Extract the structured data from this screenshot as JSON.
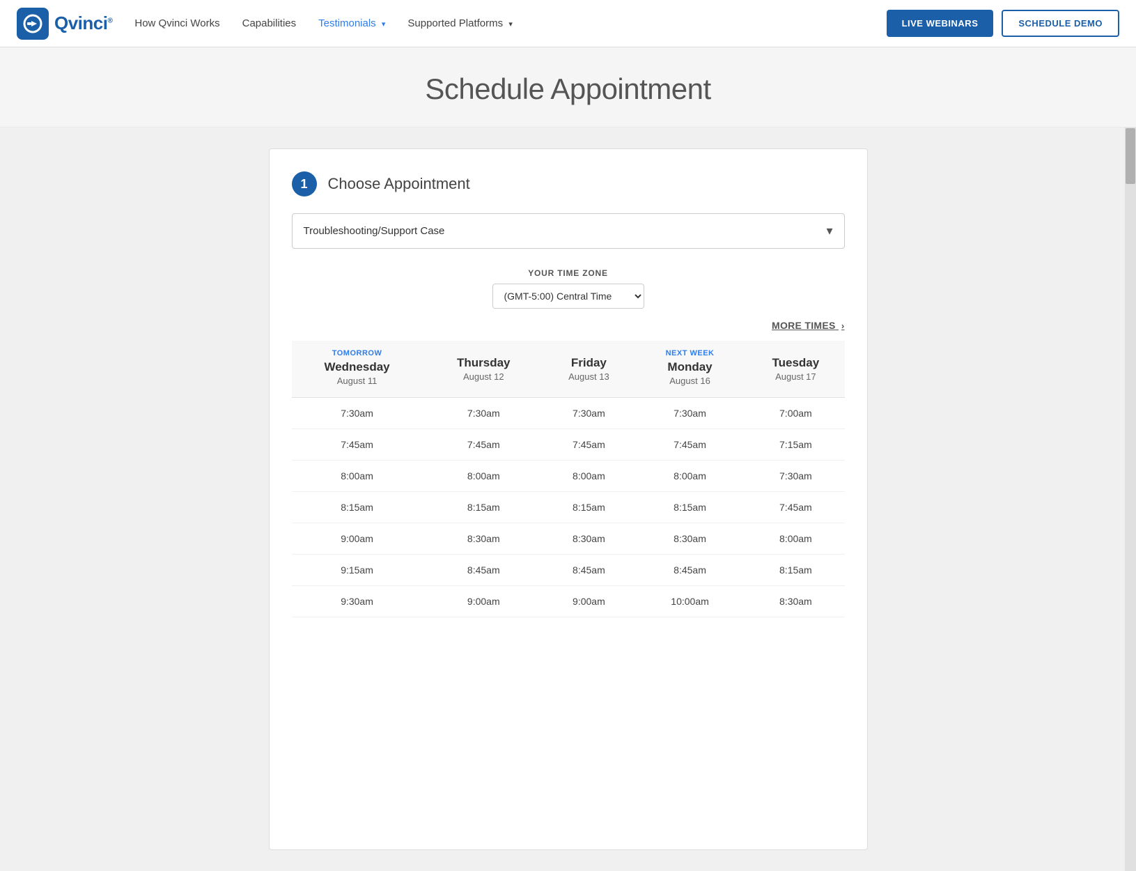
{
  "nav": {
    "logo_text": "Qvinci",
    "logo_sup": "®",
    "links": [
      {
        "label": "How Qvinci Works",
        "has_dropdown": false
      },
      {
        "label": "Capabilities",
        "has_dropdown": false
      },
      {
        "label": "Testimonials",
        "has_dropdown": true
      },
      {
        "label": "Supported Platforms",
        "has_dropdown": true
      }
    ],
    "btn_live": "LIVE WEBINARS",
    "btn_demo": "SCHEDULE DEMO"
  },
  "page": {
    "title": "Schedule Appointment"
  },
  "card": {
    "step_number": "1",
    "step_title": "Choose Appointment",
    "dropdown_label": "Troubleshooting/Support Case",
    "timezone_label": "YOUR TIME ZONE",
    "timezone_value": "(GMT-5:00) Central Time",
    "more_times": "MORE TIMES"
  },
  "calendar": {
    "columns": [
      {
        "tag": "TOMORROW",
        "day": "Wednesday",
        "date": "August 11",
        "times": [
          "7:30am",
          "7:45am",
          "8:00am",
          "8:15am",
          "9:00am",
          "9:15am",
          "9:30am"
        ]
      },
      {
        "tag": "",
        "day": "Thursday",
        "date": "August 12",
        "times": [
          "7:30am",
          "7:45am",
          "8:00am",
          "8:15am",
          "8:30am",
          "8:45am",
          "9:00am"
        ]
      },
      {
        "tag": "",
        "day": "Friday",
        "date": "August 13",
        "times": [
          "7:30am",
          "7:45am",
          "8:00am",
          "8:15am",
          "8:30am",
          "8:45am",
          "9:00am"
        ]
      },
      {
        "tag": "NEXT WEEK",
        "day": "Monday",
        "date": "August 16",
        "times": [
          "7:30am",
          "7:45am",
          "8:00am",
          "8:15am",
          "8:30am",
          "8:45am",
          "10:00am"
        ]
      },
      {
        "tag": "",
        "day": "Tuesday",
        "date": "August 17",
        "times": [
          "7:00am",
          "7:15am",
          "7:30am",
          "7:45am",
          "8:00am",
          "8:15am",
          "8:30am"
        ]
      }
    ]
  }
}
